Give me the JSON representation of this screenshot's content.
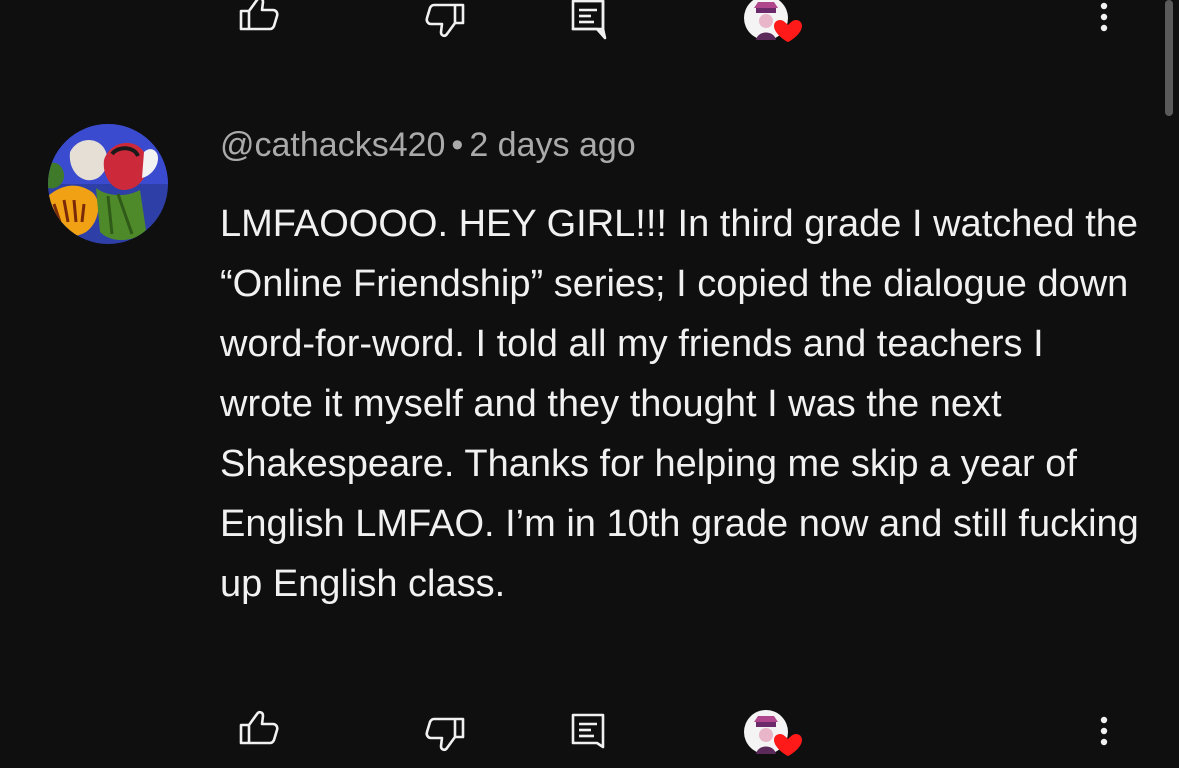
{
  "comment": {
    "handle": "@cathacks420",
    "separator": "•",
    "timestamp": "2 days ago",
    "text": "LMFAOOOO. HEY GIRL!!! In third grade I watched the “Online Friendship” series; I copied the dialogue down word-for-word. I told all my friends and teachers I wrote it myself and they thought I was the next Shakespeare. Thanks for helping me skip a year of English LMFAO. I’m in 10th grade now and still fucking up English class."
  },
  "icons": {
    "like": "thumbs-up-icon",
    "dislike": "thumbs-down-icon",
    "reply": "reply-icon",
    "creator_heart": "creator-heart-icon",
    "more": "more-vertical-icon"
  },
  "colors": {
    "background": "#0f0f0f",
    "text": "#f1f1f1",
    "meta": "#aaaaaa",
    "heart": "#ff0000"
  }
}
